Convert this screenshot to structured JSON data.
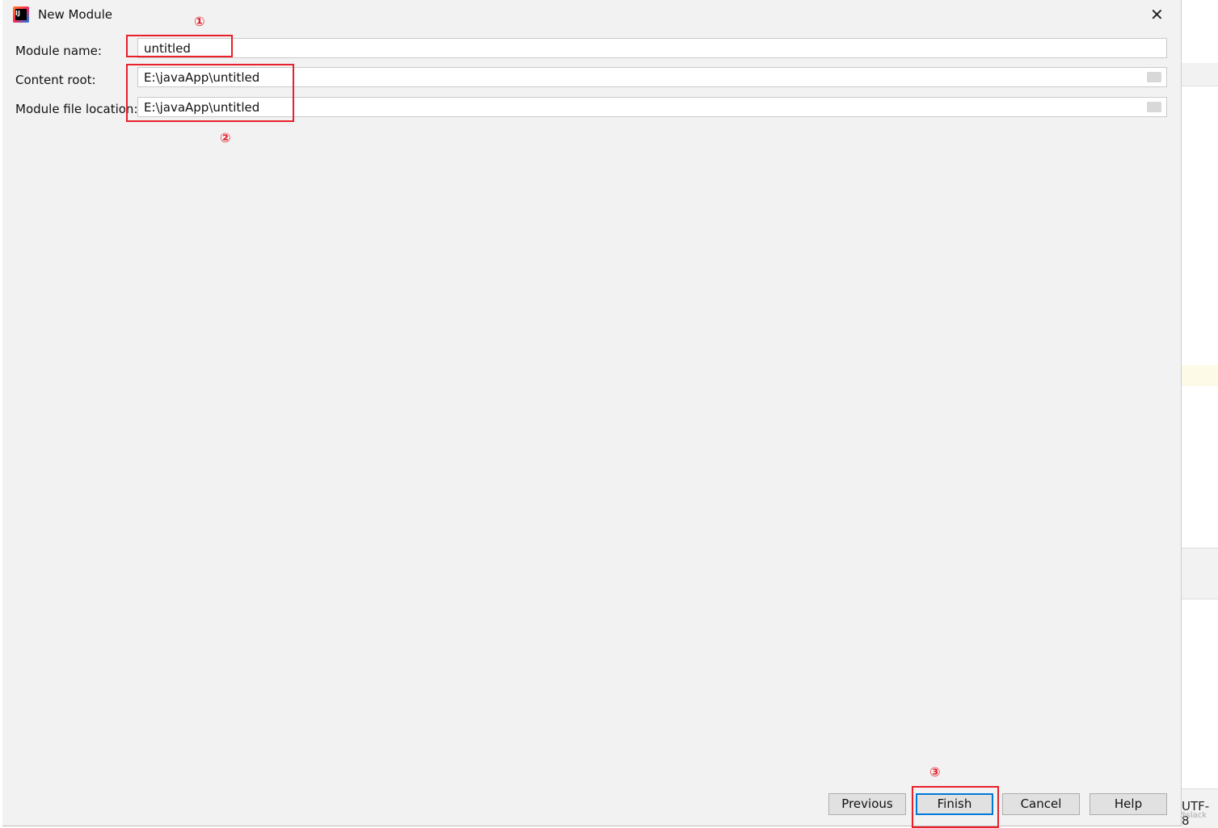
{
  "dialog": {
    "title": "New Module",
    "close_icon": "close-icon",
    "fields": {
      "module_name": {
        "label": "Module name:",
        "value": "untitled"
      },
      "content_root": {
        "label": "Content root:",
        "value": "E:\\javaApp\\untitled"
      },
      "module_file_location": {
        "label": "Module file location:",
        "value": "E:\\javaApp\\untitled"
      }
    },
    "buttons": {
      "previous": "Previous",
      "finish": "Finish",
      "cancel": "Cancel",
      "help": "Help"
    }
  },
  "annotations": {
    "one": "①",
    "two": "②",
    "three": "③",
    "color": "#e8202a"
  },
  "background": {
    "encoding": "UTF-8",
    "watermark": "CSDN @slack"
  },
  "colors": {
    "primary_button_border": "#0078d7",
    "dialog_bg": "#f2f2f2"
  }
}
